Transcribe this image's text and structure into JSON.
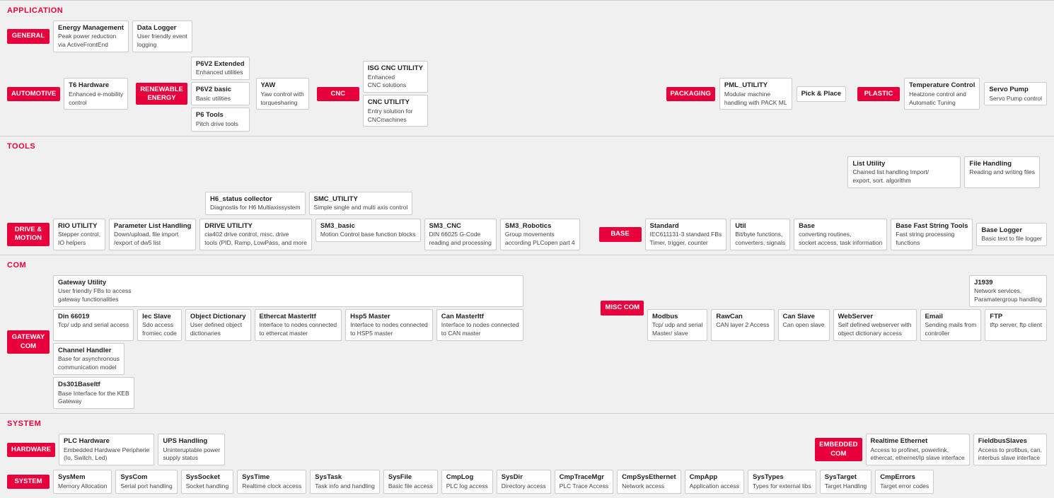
{
  "sections": {
    "application": {
      "title": "APPLICATION",
      "general": {
        "label": "GENERAL",
        "items": [
          {
            "title": "Energy Management",
            "desc": "Peak power reduction\nvia ActiveFrontEnd"
          },
          {
            "title": "Data Logger",
            "desc": "User friendly event\nlogging"
          }
        ]
      },
      "automotive": {
        "label": "AUTOMOTIVE",
        "items": [
          {
            "title": "T6 Hardware",
            "desc": "Enhanced e-mobility\ncontrol"
          }
        ]
      },
      "renewable": {
        "label": "RENEWABLE\nENERGY",
        "sub_items": [
          {
            "title": "P6V2 Extended",
            "desc": "Enhanced utilities"
          },
          {
            "title": "P6V2 basic",
            "desc": "Basic utilities"
          },
          {
            "title": "P6 Tools",
            "desc": "Pitch drive tools"
          }
        ]
      },
      "yaw": {
        "title": "YAW",
        "desc": "Yaw control with\ntorquesharing"
      },
      "cnc": {
        "label": "CNC",
        "items": [
          {
            "title": "ISG CNC UTILITY",
            "desc": "Enhanced\nCNC solutions"
          },
          {
            "title": "CNC UTILITY",
            "desc": "Entry solution for\nCNCmachines"
          }
        ]
      },
      "packaging": {
        "label": "PACKAGING",
        "items": [
          {
            "title": "PML_UTILITY",
            "desc": "Modular machine\nhandling with PACK ML"
          },
          {
            "title": "Pick & Place",
            "desc": ""
          }
        ]
      },
      "plastic": {
        "label": "PLASTIC",
        "items": [
          {
            "title": "Temperature Control",
            "desc": "Heatzone control and\nAutomatic Tuning"
          },
          {
            "title": "Servo Pump",
            "desc": "Servo Pump control"
          }
        ]
      }
    },
    "tools": {
      "title": "TOOLS",
      "listutility": {
        "title": "List Utility",
        "desc": "Chained list handling Import/\nexport, sort. algorithm"
      },
      "filehandling": {
        "title": "File Handling",
        "desc": "Reading and writing files"
      },
      "h6status": {
        "title": "H6_status collector",
        "desc": "Diagnostis for H6 Multiaxissystem"
      },
      "smcutility": {
        "title": "SMC_UTILITY",
        "desc": "Simple single and multi axis control"
      },
      "drive_motion": {
        "label": "DRIVE &\nMOTION",
        "items": [
          {
            "title": "RIO UTILITY",
            "desc": "Stepper control,\nIO helpers"
          },
          {
            "title": "Parameter List Handling",
            "desc": "Down/upload, file import\n/export of dw5 list"
          },
          {
            "title": "DRIVE UTILITY",
            "desc": "cia402 drive control, misc. drive\ntools (PID, Ramp, LowPass, and more"
          },
          {
            "title": "SM3_basic",
            "desc": "Motion Control base function blocks"
          },
          {
            "title": "SM3_CNC",
            "desc": "DIN 66025 G-Code\nreading and processing"
          },
          {
            "title": "SM3_Robotics",
            "desc": "Group movements\naccording PLCopen part 4"
          }
        ]
      },
      "base": {
        "label": "BASE",
        "items": [
          {
            "title": "Standard",
            "desc": "IEC611131-3 standard FBs\nTimer, trigger, counter"
          },
          {
            "title": "Util",
            "desc": "Bit/byte functions,\nconverters, signals"
          },
          {
            "title": "Base",
            "desc": "converting routines,\nsocket access, task information"
          },
          {
            "title": "Base Fast String Tools",
            "desc": "Fast string processing\nfunctions"
          },
          {
            "title": "Base Logger",
            "desc": "Basic text to file logger"
          }
        ]
      }
    },
    "com": {
      "title": "COM",
      "gateway": {
        "label": "GATEWAY\nCOM",
        "items": [
          {
            "title": "Gateway Utility",
            "desc": "User friendly FBs to access\ngateway functionalities"
          },
          {
            "title": "Din 66019",
            "desc": "Tcp/ udp and serial access"
          },
          {
            "title": "Channel Handler",
            "desc": "Base for asynchronous\ncommunication model"
          },
          {
            "title": "Ds301BaseItf",
            "desc": "Base Interface for the KEB\nGateway"
          }
        ]
      },
      "protocols": [
        {
          "title": "Iec Slave",
          "desc": "Sdo access\nfromiec code"
        },
        {
          "title": "Object Dictionary",
          "desc": "User defined object\ndictionaries"
        },
        {
          "title": "Ethercat MasterItf",
          "desc": "Interface to nodes connected\nto ethercat master"
        },
        {
          "title": "Hsp5 Master",
          "desc": "Interface to nodes connected\nto HSP5 master"
        },
        {
          "title": "Can MasterItf",
          "desc": "Interface to nodes connected\nto CAN master"
        }
      ],
      "misc": {
        "label": "MISC COM",
        "items": [
          {
            "title": "J1939",
            "desc": "Network services,\nParamatergroup handling"
          },
          {
            "title": "Modbus",
            "desc": "Tcp/ udp and serial\nMaster/ slave"
          },
          {
            "title": "RawCan",
            "desc": "CAN layer 2 Access"
          },
          {
            "title": "Can Slave",
            "desc": "Can open slave"
          },
          {
            "title": "WebServer",
            "desc": "Self defined webserver with\nobject dictionary access"
          },
          {
            "title": "Email",
            "desc": "Sending mails from\ncontroller"
          },
          {
            "title": "FTP",
            "desc": "tftp server, ftp client"
          }
        ]
      }
    },
    "system": {
      "title": "SYSTEM",
      "hardware": {
        "label": "HARDWARE",
        "items": [
          {
            "title": "PLC Hardware",
            "desc": "Embedded Hardware Peripherie\n(Io, Switch, Led)"
          },
          {
            "title": "UPS Handling",
            "desc": "Uninteruptable power\nsupply status"
          }
        ]
      },
      "embedded": {
        "label": "EMBEDDED\nCOM",
        "items": [
          {
            "title": "Realtime Ethernet",
            "desc": "Access to profinet, powerlink,\nethercat, ethernet/Ip slave interface"
          },
          {
            "title": "FieldbusSlaves",
            "desc": "Access to profibus, can,\ninterbus slave interface"
          }
        ]
      },
      "system_badge": {
        "label": "SYSTEM",
        "items": [
          {
            "title": "SysMem",
            "desc": "Memory Allocation"
          },
          {
            "title": "SysCom",
            "desc": "Serial port handling"
          },
          {
            "title": "SysSocket",
            "desc": "Socket handling"
          },
          {
            "title": "SysTime",
            "desc": "Realtime clock access"
          },
          {
            "title": "SysTask",
            "desc": "Task info and handling"
          },
          {
            "title": "SysFile",
            "desc": "Basic file access"
          },
          {
            "title": "CmpLog",
            "desc": "PLC log access"
          },
          {
            "title": "SysDir",
            "desc": "Directory access"
          },
          {
            "title": "CmpTraceMgr",
            "desc": "PLC Trace Access"
          },
          {
            "title": "CmpSysEthernet",
            "desc": "Network access"
          },
          {
            "title": "CmpApp",
            "desc": "Application access"
          },
          {
            "title": "SysTypes",
            "desc": "Types for external libs"
          },
          {
            "title": "SysTarget",
            "desc": "Target Handling"
          },
          {
            "title": "CmpErrors",
            "desc": "Target error codes"
          }
        ]
      }
    }
  }
}
